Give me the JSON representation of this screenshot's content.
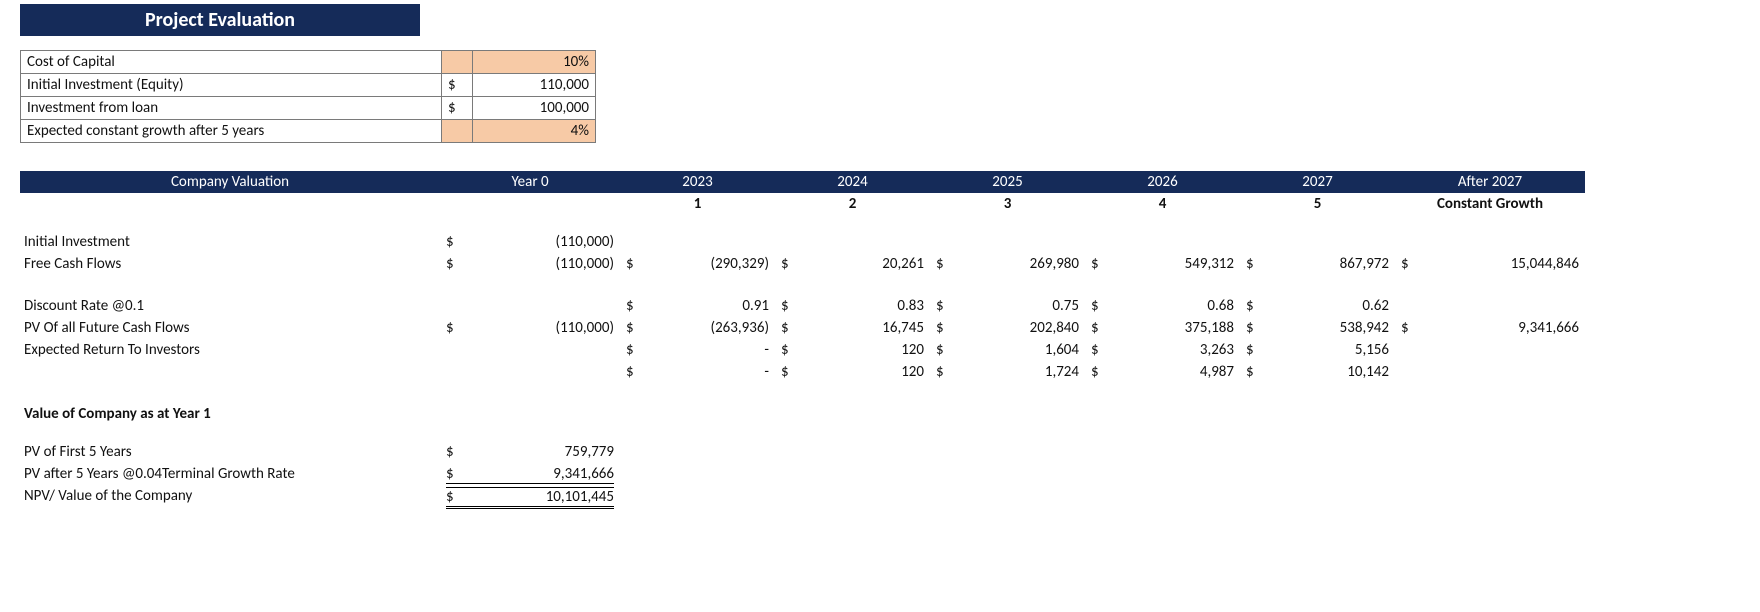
{
  "title": "Project Evaluation",
  "inputs": {
    "rows": [
      {
        "label": "Cost of Capital",
        "currency": "",
        "value": "10%",
        "peach": true
      },
      {
        "label": "Initial Investment (Equity)",
        "currency": "$",
        "value": "110,000",
        "peach": false
      },
      {
        "label": "Investment from loan",
        "currency": "$",
        "value": "100,000",
        "peach": false
      },
      {
        "label": "Expected constant growth after 5 years",
        "currency": "",
        "value": "4%",
        "peach": true
      }
    ]
  },
  "valuation": {
    "header": {
      "c0": "Company Valuation",
      "c1": "Year 0",
      "years": [
        "2023",
        "2024",
        "2025",
        "2026",
        "2027"
      ],
      "after": "After 2027",
      "index": [
        "1",
        "2",
        "3",
        "4",
        "5"
      ],
      "after_sub": "Constant Growth"
    },
    "rows": [
      {
        "label": "Initial Investment",
        "cells": [
          {
            "cur": "$",
            "val": "(110,000)"
          },
          {
            "cur": "",
            "val": ""
          },
          {
            "cur": "",
            "val": ""
          },
          {
            "cur": "",
            "val": ""
          },
          {
            "cur": "",
            "val": ""
          },
          {
            "cur": "",
            "val": ""
          },
          {
            "cur": "",
            "val": ""
          }
        ]
      },
      {
        "label": "Free Cash Flows",
        "cells": [
          {
            "cur": "$",
            "val": "(110,000)"
          },
          {
            "cur": "$",
            "val": "(290,329)"
          },
          {
            "cur": "$",
            "val": "20,261"
          },
          {
            "cur": "$",
            "val": "269,980"
          },
          {
            "cur": "$",
            "val": "549,312"
          },
          {
            "cur": "$",
            "val": "867,972"
          },
          {
            "cur": "$",
            "val": "15,044,846"
          }
        ]
      },
      {
        "label": "",
        "spacer": true
      },
      {
        "label": "Discount Rate @0.1",
        "cells": [
          {
            "cur": "",
            "val": ""
          },
          {
            "cur": "$",
            "val": "0.91"
          },
          {
            "cur": "$",
            "val": "0.83"
          },
          {
            "cur": "$",
            "val": "0.75"
          },
          {
            "cur": "$",
            "val": "0.68"
          },
          {
            "cur": "$",
            "val": "0.62"
          },
          {
            "cur": "",
            "val": ""
          }
        ]
      },
      {
        "label": "PV Of all Future Cash Flows",
        "cells": [
          {
            "cur": "$",
            "val": "(110,000)"
          },
          {
            "cur": "$",
            "val": "(263,936)"
          },
          {
            "cur": "$",
            "val": "16,745"
          },
          {
            "cur": "$",
            "val": "202,840"
          },
          {
            "cur": "$",
            "val": "375,188"
          },
          {
            "cur": "$",
            "val": "538,942"
          },
          {
            "cur": "$",
            "val": "9,341,666"
          }
        ]
      },
      {
        "label": "Expected Return To Investors",
        "cells": [
          {
            "cur": "",
            "val": ""
          },
          {
            "cur": "$",
            "val": "-"
          },
          {
            "cur": "$",
            "val": "120"
          },
          {
            "cur": "$",
            "val": "1,604"
          },
          {
            "cur": "$",
            "val": "3,263"
          },
          {
            "cur": "$",
            "val": "5,156"
          },
          {
            "cur": "",
            "val": ""
          }
        ]
      },
      {
        "label": "",
        "cells": [
          {
            "cur": "",
            "val": ""
          },
          {
            "cur": "$",
            "val": "-"
          },
          {
            "cur": "$",
            "val": "120"
          },
          {
            "cur": "$",
            "val": "1,724"
          },
          {
            "cur": "$",
            "val": "4,987"
          },
          {
            "cur": "$",
            "val": "10,142"
          },
          {
            "cur": "",
            "val": ""
          }
        ]
      }
    ],
    "summary": {
      "title": "Value of Company as at Year 1",
      "rows": [
        {
          "label": "PV of First 5 Years",
          "cur": "$",
          "val": "759,779",
          "style": ""
        },
        {
          "label": "PV after 5 Years @0.04Terminal Growth Rate",
          "cur": "$",
          "val": "9,341,666",
          "style": "uline"
        },
        {
          "label": "NPV/ Value of the Company",
          "cur": "$",
          "val": "10,101,445",
          "style": "dbl"
        }
      ]
    }
  }
}
